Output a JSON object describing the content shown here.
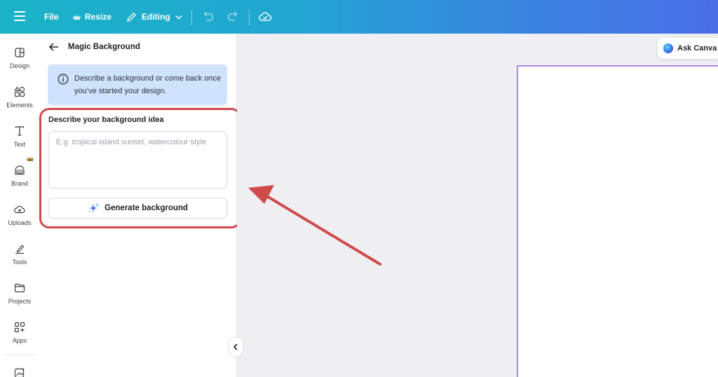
{
  "topbar": {
    "file_label": "File",
    "resize_label": "Resize",
    "editing_label": "Editing"
  },
  "rail": {
    "items": [
      {
        "label": "Design",
        "icon": "layout-icon"
      },
      {
        "label": "Elements",
        "icon": "shapes-icon"
      },
      {
        "label": "Text",
        "icon": "text-icon"
      },
      {
        "label": "Brand",
        "icon": "brand-icon"
      },
      {
        "label": "Uploads",
        "icon": "cloud-upload-icon"
      },
      {
        "label": "Tools",
        "icon": "pen-icon"
      },
      {
        "label": "Projects",
        "icon": "folder-icon"
      },
      {
        "label": "Apps",
        "icon": "apps-icon"
      }
    ]
  },
  "panel": {
    "title": "Magic Background",
    "info_text": "Describe a background or come back once you’ve started your design.",
    "field_label": "Describe your background idea",
    "placeholder": "E.g. tropical island sunset, watercolour style",
    "generate_label": "Generate background"
  },
  "canvas": {
    "ask_label": "Ask Canva"
  },
  "colors": {
    "annotation": "#cf4a4a",
    "info_bg": "#cfe3fd",
    "page_border": "#a98bea"
  }
}
